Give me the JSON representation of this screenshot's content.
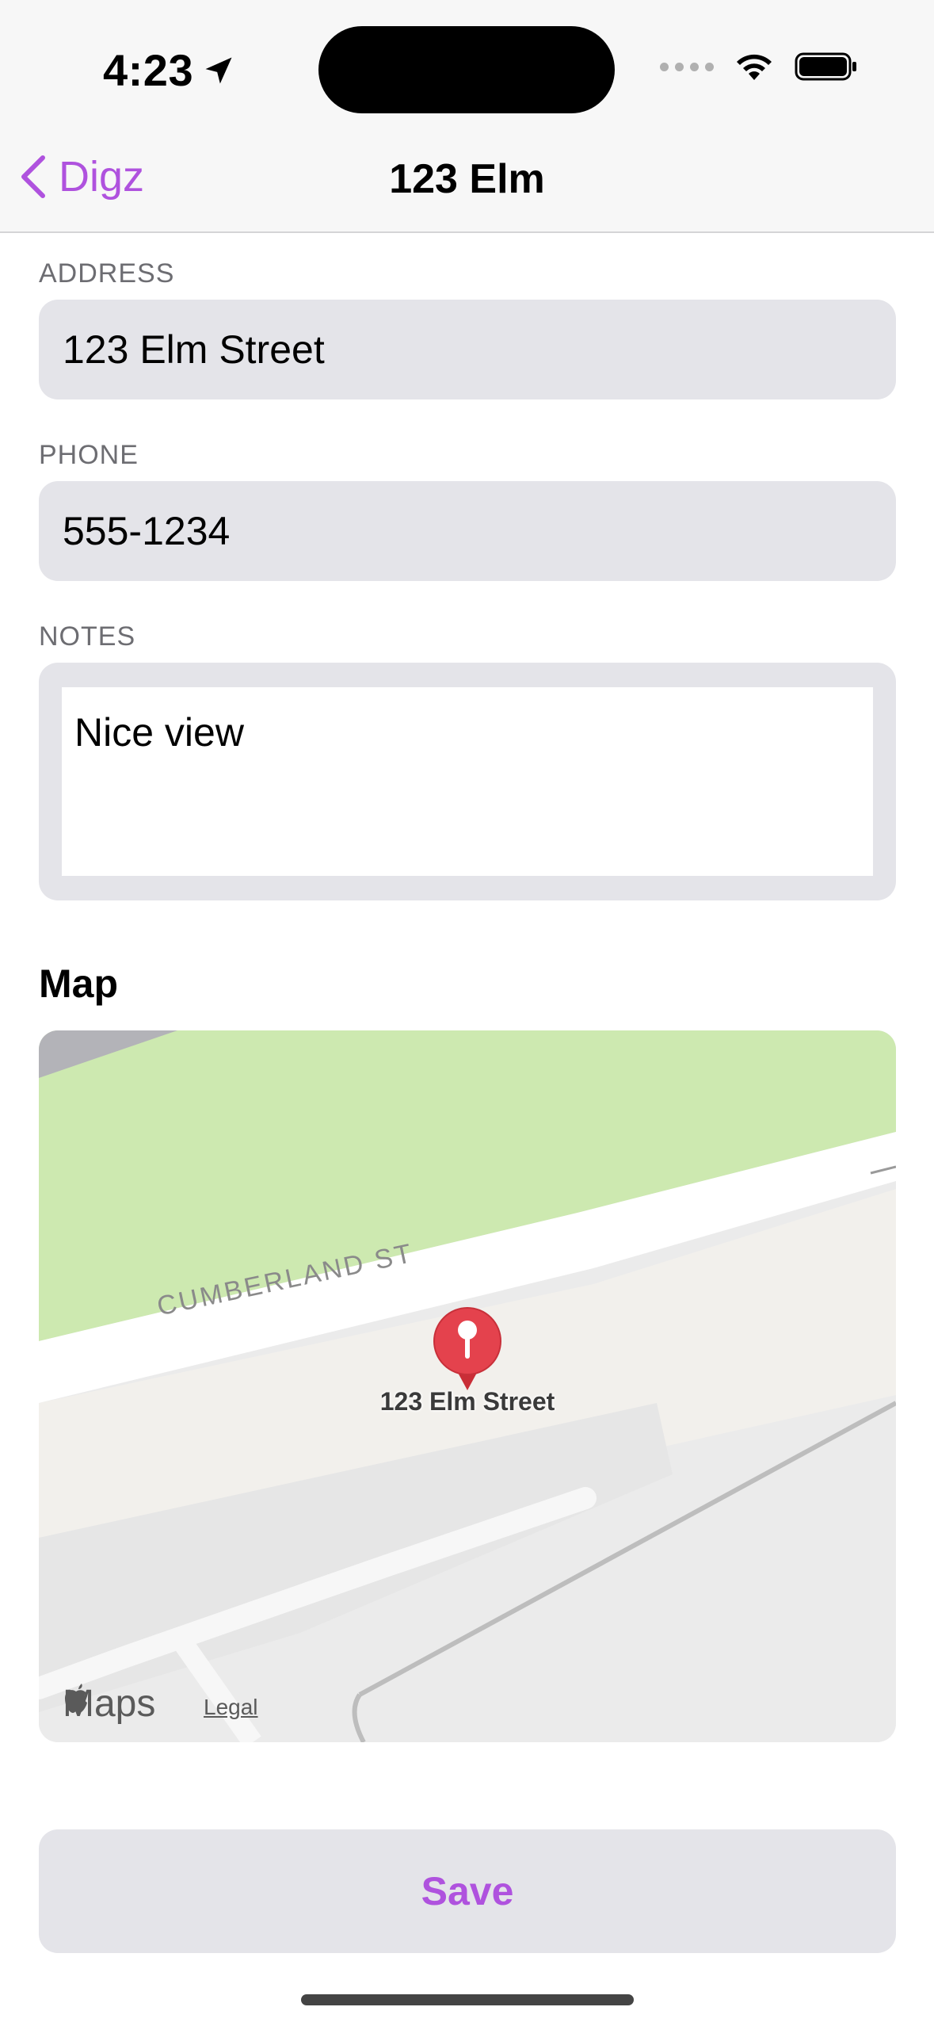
{
  "status_bar": {
    "time": "4:23",
    "location_icon": "location-arrow-icon",
    "wifi_icon": "wifi-icon",
    "battery_icon": "battery-icon"
  },
  "nav": {
    "back_label": "Digz",
    "back_icon": "chevron-left-icon",
    "title": "123 Elm"
  },
  "form": {
    "address": {
      "label": "ADDRESS",
      "value": "123 Elm Street"
    },
    "phone": {
      "label": "PHONE",
      "value": "555-1234"
    },
    "notes": {
      "label": "NOTES",
      "value": "Nice view"
    }
  },
  "map": {
    "heading": "Map",
    "street_label": "CUMBERLAND ST",
    "pin_label": "123 Elm Street",
    "brand": "Maps",
    "legal": "Legal"
  },
  "actions": {
    "save_label": "Save"
  },
  "colors": {
    "accent": "#af52de",
    "field_bg": "#e4e4e9",
    "park_green": "#cde9b0"
  }
}
